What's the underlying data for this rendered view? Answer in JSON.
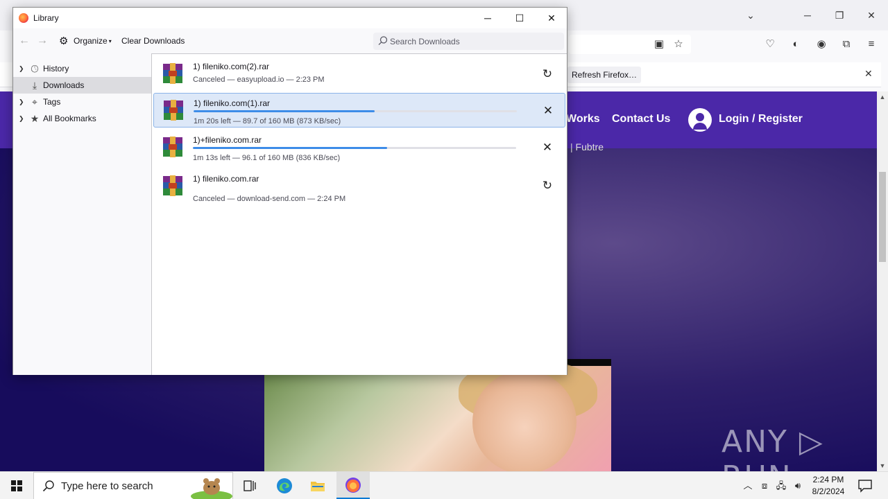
{
  "browser": {
    "notification_button": "Refresh Firefox…",
    "site_nav": [
      "Works",
      "Contact Us",
      "Login / Register"
    ],
    "site_subtitle": "| Fubtre",
    "watermark": "ANY ▷ RUN"
  },
  "library": {
    "title": "Library",
    "organize_label": "Organize",
    "clear_downloads_label": "Clear Downloads",
    "search_placeholder": "Search Downloads",
    "sidebar": [
      {
        "label": "History",
        "icon": "clock-icon",
        "selected": false
      },
      {
        "label": "Downloads",
        "icon": "download-icon",
        "selected": true
      },
      {
        "label": "Tags",
        "icon": "tag-icon",
        "selected": false
      },
      {
        "label": "All Bookmarks",
        "icon": "star-icon",
        "selected": false
      }
    ],
    "downloads": [
      {
        "name": "1) fileniko.com(2).rar",
        "status": "Canceled — easyupload.io — 2:23 PM",
        "action": "retry"
      },
      {
        "name": "1) fileniko.com(1).rar",
        "status": "1m 20s left — 89.7 of 160 MB (873 KB/sec)",
        "progress": 0.56,
        "action": "cancel",
        "selected": true
      },
      {
        "name": "1)+fileniko.com.rar",
        "status": "1m 13s left — 96.1 of 160 MB (836 KB/sec)",
        "progress": 0.6,
        "action": "cancel"
      },
      {
        "name": "1) fileniko.com.rar",
        "status": "Canceled — download-send.com — 2:24 PM",
        "action": "retry"
      }
    ]
  },
  "taskbar": {
    "search_placeholder": "Type here to search",
    "time": "2:24 PM",
    "date": "8/2/2024"
  },
  "colors": {
    "site_header": "#4b28a8",
    "progress": "#3d8ce8",
    "selected_row": "#dde8f8"
  }
}
